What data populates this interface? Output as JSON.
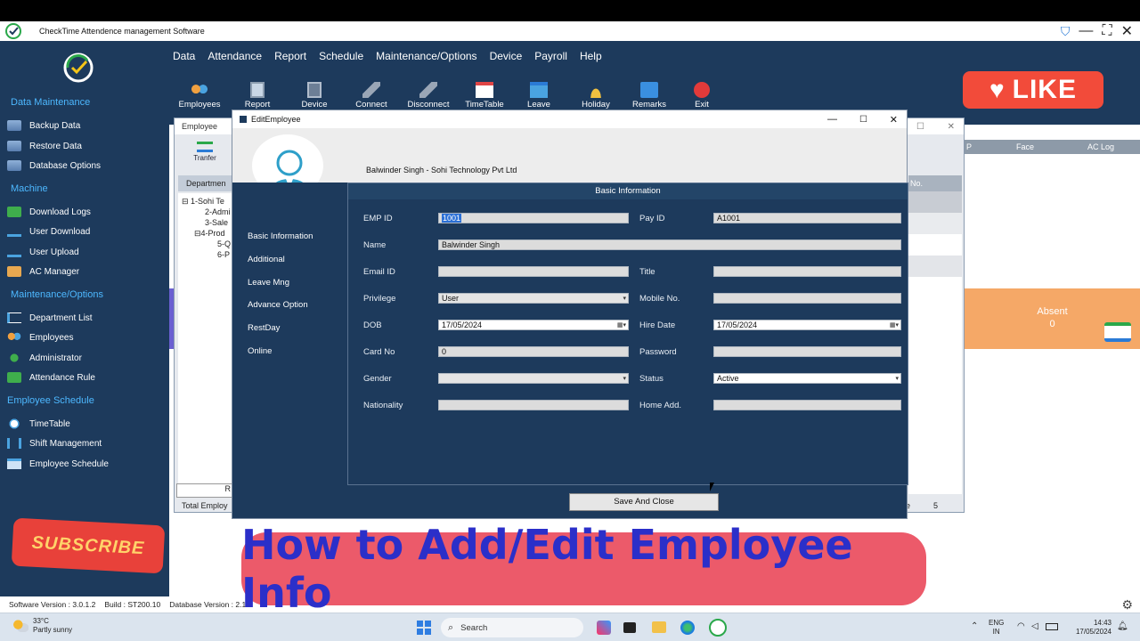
{
  "app": {
    "title": "CheckTime Attendence management Software",
    "menu": [
      "Data",
      "Attendance",
      "Report",
      "Schedule",
      "Maintenance/Options",
      "Device",
      "Payroll",
      "Help"
    ],
    "toolbar": [
      "Employees",
      "Report",
      "Device",
      "Connect",
      "Disconnect",
      "TimeTable",
      "Leave",
      "Holiday",
      "Remarks",
      "Exit"
    ]
  },
  "sidebar": {
    "sections": [
      {
        "title": "Data Maintenance",
        "items": [
          "Backup Data",
          "Restore Data",
          "Database Options"
        ]
      },
      {
        "title": "Machine",
        "items": [
          "Download Logs",
          "User Download",
          "User Upload",
          "AC Manager"
        ]
      },
      {
        "title": "Maintenance/Options",
        "items": [
          "Department List",
          "Employees",
          "Administrator",
          "Attendance Rule"
        ]
      },
      {
        "title": "Employee Schedule",
        "items": [
          "TimeTable",
          "Shift Management",
          "Employee Schedule"
        ]
      }
    ]
  },
  "employee_window": {
    "title": "Employee",
    "tranfer": "Tranfer",
    "department_header": "Departmen",
    "tree": [
      "1-Sohi Te",
      "2-Admi",
      "3-Sale",
      "4-Prod",
      "5-Q",
      "6-P"
    ],
    "total_label": "Total Employ",
    "right_count": "5",
    "right_headers": [
      "P",
      "Face",
      "AC Log"
    ],
    "no_col": "No.",
    "absent_label": "Absent",
    "absent_value": "0",
    "button_r": "R",
    "e_label": "e"
  },
  "dialog": {
    "title": "EditEmployee",
    "header_name": "Balwinder Singh - Sohi Technology Pvt Ltd",
    "nav": [
      "Basic Information",
      "Additional",
      "Leave Mng",
      "Advance Option",
      "RestDay",
      "Online"
    ],
    "panel_title": "Basic Information",
    "fields": {
      "emp_id_label": "EMP ID",
      "emp_id": "1001",
      "pay_id_label": "Pay ID",
      "pay_id": "A1001",
      "name_label": "Name",
      "name": "Balwinder Singh",
      "email_label": "Email ID",
      "email": "",
      "title_label": "Title",
      "title": "",
      "privilege_label": "Privilege",
      "privilege": "User",
      "mobile_label": "Mobile No.",
      "mobile": "",
      "dob_label": "DOB",
      "dob": "17/05/2024",
      "hire_label": "Hire Date",
      "hire": "17/05/2024",
      "card_label": "Card No",
      "card": "0",
      "password_label": "Password",
      "password": "",
      "gender_label": "Gender",
      "gender": "",
      "status_label": "Status",
      "status": "Active",
      "nationality_label": "Nationality",
      "nationality": "",
      "home_label": "Home Add.",
      "home": ""
    },
    "save_label": "Save And Close"
  },
  "status": {
    "version": "Software Version : 3.0.1.2",
    "build": "Build : ST200.10",
    "db": "Database Version : 2.1"
  },
  "taskbar": {
    "weather_temp": "33°C",
    "weather_desc": "Partly sunny",
    "search": "Search",
    "lang1": "ENG",
    "lang2": "IN",
    "time": "14:43",
    "date": "17/05/2024"
  },
  "overlay": {
    "like": "LIKE",
    "subscribe": "SUBSCRIBE",
    "banner": "How to Add/Edit Employee Info"
  },
  "colors": {
    "app_bg": "#1d3a5c",
    "accent": "#4db8ff",
    "like": "#f24b3a",
    "banner": "#ec5a6a",
    "banner_text": "#2b2fc9",
    "absent": "#f5a867"
  }
}
